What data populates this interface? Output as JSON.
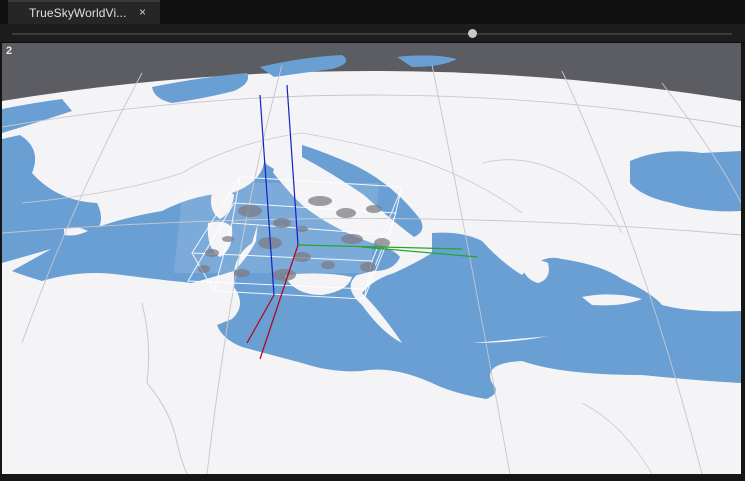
{
  "tab": {
    "title": "TrueSkyWorldVi...",
    "close_glyph": "×"
  },
  "timeline": {
    "position": 0.64
  },
  "viewport": {
    "index_label": "2",
    "colors": {
      "sky": "#5c5c63",
      "sea": "#6a9fd4",
      "land": "#f4f4f6",
      "grid": "#c6c6cc",
      "axis_x": "#b3001b",
      "axis_y": "#1fa82a",
      "axis_z": "#1420c8",
      "cloud_box": "#ffffff"
    }
  }
}
